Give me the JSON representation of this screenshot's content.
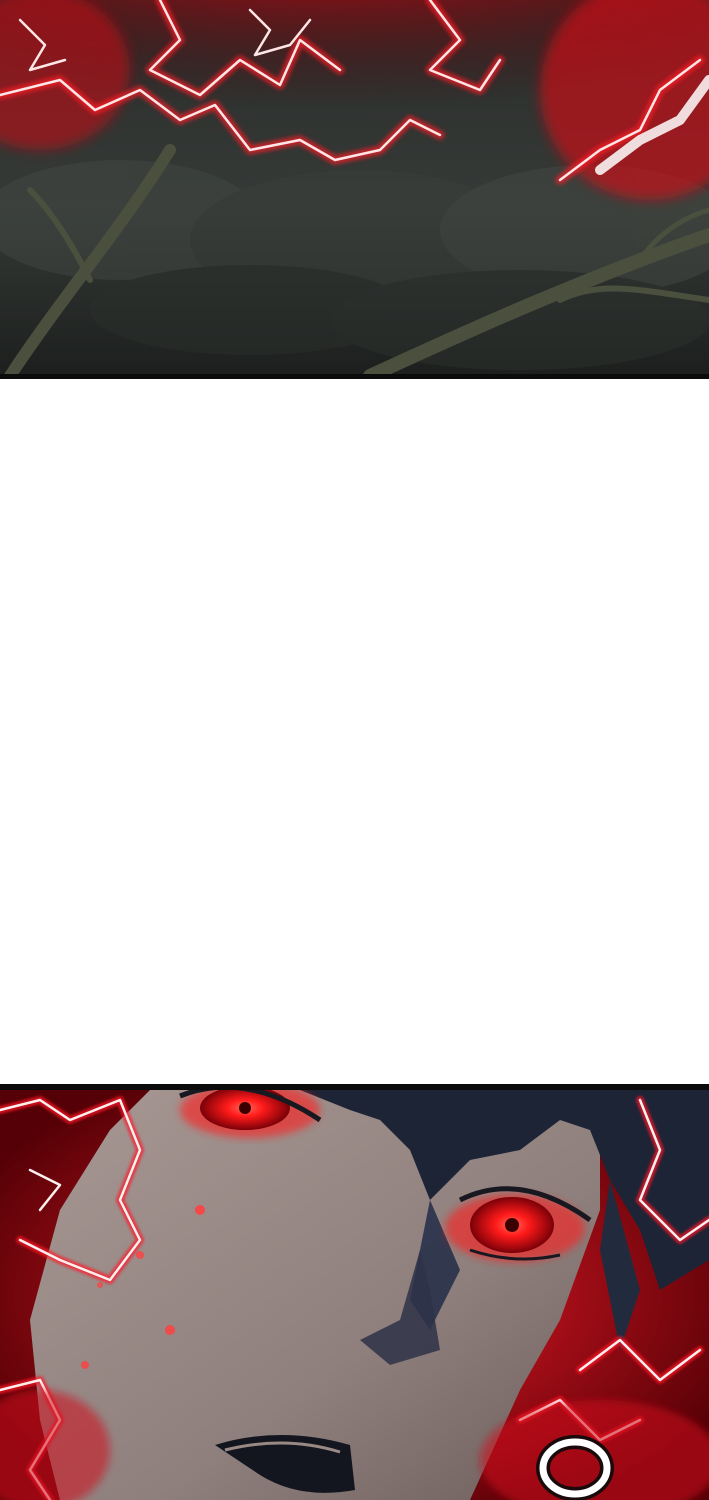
{
  "reader": {
    "panels": [
      {
        "id": "panel-forest-lightning",
        "scene": "red-lightning-over-dark-forest"
      },
      {
        "id": "panel-glowing-eyes",
        "scene": "face-with-glowing-red-eyes"
      }
    ]
  },
  "colors": {
    "lightning_core": "#ffffff",
    "lightning_glow": "#e0101c",
    "forest_dark": "#1f2220",
    "forest_mid": "#3b403c",
    "branch": "#4a4f3e",
    "skin": "#9a8a86",
    "hair": "#1d2436",
    "eye_red": "#ff2020",
    "border": "#0b0b0b"
  }
}
